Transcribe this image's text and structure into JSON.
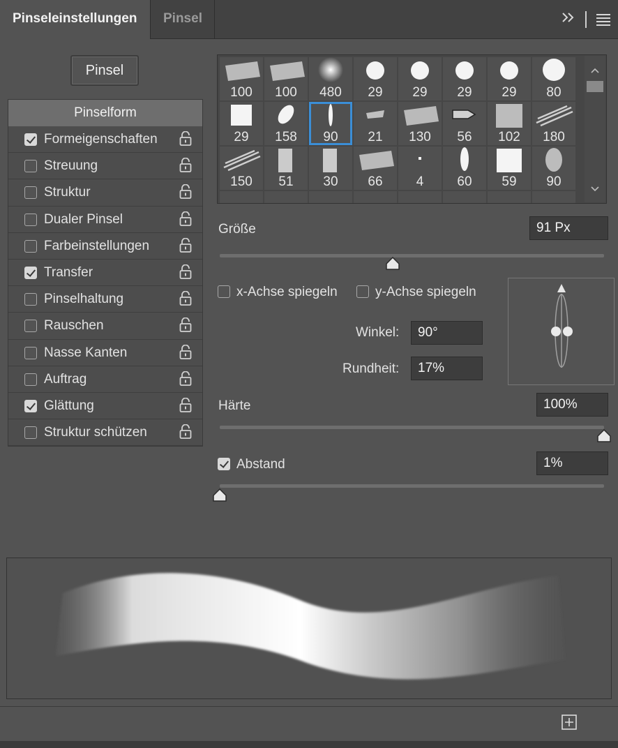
{
  "tabs": {
    "active": "Pinseleinstellungen",
    "inactive": "Pinsel"
  },
  "toolbar": {
    "expand_icon": "double-chevron-right-icon",
    "menu_icon": "hamburger-menu-icon"
  },
  "left": {
    "pinsel_button": "Pinsel",
    "header": "Pinselform",
    "items": [
      {
        "label": "Formeigenschaften",
        "checked": true
      },
      {
        "label": "Streuung",
        "checked": false
      },
      {
        "label": "Struktur",
        "checked": false
      },
      {
        "label": "Dualer Pinsel",
        "checked": false
      },
      {
        "label": "Farbeinstellungen",
        "checked": false
      },
      {
        "label": "Transfer",
        "checked": true
      },
      {
        "label": "Pinselhaltung",
        "checked": false
      },
      {
        "label": "Rauschen",
        "checked": false
      },
      {
        "label": "Nasse Kanten",
        "checked": false
      },
      {
        "label": "Auftrag",
        "checked": false
      },
      {
        "label": "Glättung",
        "checked": true
      },
      {
        "label": "Struktur schützen",
        "checked": false
      }
    ]
  },
  "brushes": [
    [
      "100",
      "100",
      "480",
      "29",
      "29",
      "29",
      "29",
      "80"
    ],
    [
      "29",
      "158",
      "90",
      "21",
      "130",
      "56",
      "102",
      "180"
    ],
    [
      "150",
      "51",
      "30",
      "66",
      "4",
      "60",
      "59",
      "90"
    ]
  ],
  "selected_brush": "90",
  "size": {
    "label": "Größe",
    "value": "91 Px",
    "slider_fraction": 0.45
  },
  "flip_x": {
    "label": "x-Achse spiegeln",
    "checked": false
  },
  "flip_y": {
    "label": "y-Achse spiegeln",
    "checked": false
  },
  "angle": {
    "label": "Winkel:",
    "value": "90°"
  },
  "roundness": {
    "label": "Rundheit:",
    "value": "17%"
  },
  "hardness": {
    "label": "Härte",
    "value": "100%",
    "slider_fraction": 1.0
  },
  "spacing": {
    "label": "Abstand",
    "value": "1%",
    "checked": true,
    "slider_fraction": 0.0
  },
  "colors": {
    "accent": "#3b8ed6",
    "panel": "#535353"
  }
}
